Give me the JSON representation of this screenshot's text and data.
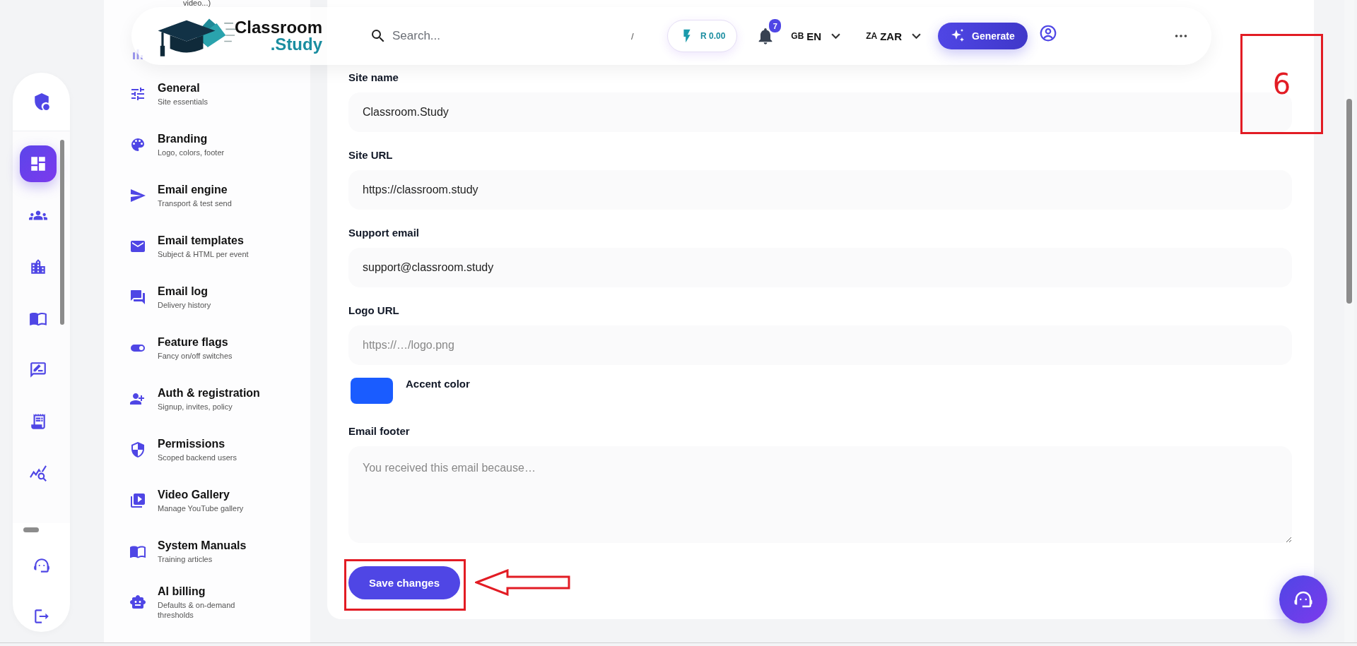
{
  "header": {
    "logo": {
      "line_1": "Classroom",
      "line_2": ".Study"
    },
    "search": {
      "placeholder": "Search...",
      "shortcut": "/"
    },
    "balance": "R 0.00",
    "notifications": {
      "count": "7"
    },
    "language": {
      "flag": "GB",
      "code": "EN"
    },
    "currency": {
      "flag": "ZA",
      "code": "ZAR"
    },
    "generate_button": "Generate"
  },
  "rail": {
    "nav_items": [
      {
        "selected": true
      },
      {
        "selected": false
      },
      {
        "selected": false
      },
      {
        "selected": false
      },
      {
        "selected": false
      },
      {
        "selected": false
      },
      {
        "selected": false
      }
    ]
  },
  "sidebar": {
    "clipped_text": "video...)",
    "items": [
      {
        "title": "General",
        "subtitle": "Site essentials"
      },
      {
        "title": "Branding",
        "subtitle": "Logo, colors, footer"
      },
      {
        "title": "Email engine",
        "subtitle": "Transport & test send"
      },
      {
        "title": "Email templates",
        "subtitle": "Subject & HTML per event"
      },
      {
        "title": "Email log",
        "subtitle": "Delivery history"
      },
      {
        "title": "Feature flags",
        "subtitle": "Fancy on/off switches"
      },
      {
        "title": "Auth & registration",
        "subtitle": "Signup, invites, policy"
      },
      {
        "title": "Permissions",
        "subtitle": "Scoped backend users"
      },
      {
        "title": "Video Gallery",
        "subtitle": "Manage YouTube gallery"
      },
      {
        "title": "System Manuals",
        "subtitle": "Training articles"
      },
      {
        "title": "AI billing",
        "subtitle": "Defaults & on-demand thresholds"
      }
    ]
  },
  "form": {
    "fields": [
      {
        "kind": "text",
        "label": "Site name",
        "value": "Classroom.Study"
      },
      {
        "kind": "text",
        "label": "Site URL",
        "value": "https://classroom.study"
      },
      {
        "kind": "text",
        "label": "Support email",
        "value": "support@classroom.study"
      },
      {
        "kind": "text",
        "label": "Logo URL",
        "placeholder": "https://…/logo.png"
      },
      {
        "kind": "color",
        "label": "Accent color",
        "color": "#1a5cff"
      },
      {
        "kind": "textarea",
        "label": "Email footer",
        "placeholder": "You received this email because…"
      }
    ],
    "save_button": "Save changes"
  },
  "annotations": {
    "step_number": "6"
  }
}
